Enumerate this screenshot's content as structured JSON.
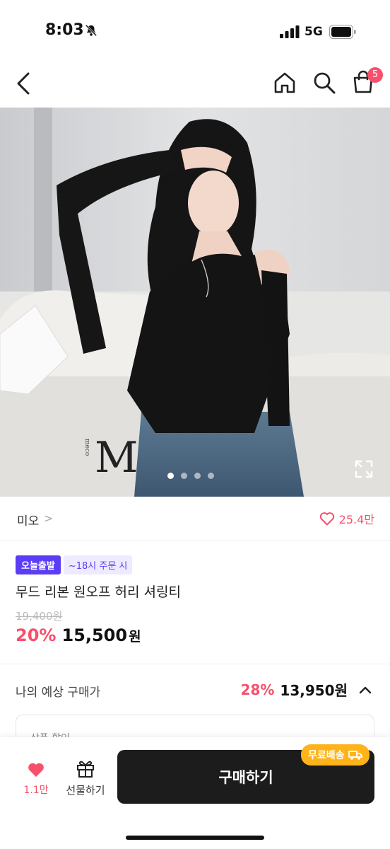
{
  "status_bar": {
    "time": "8:03",
    "network": "5G"
  },
  "nav": {
    "cart_count": "5"
  },
  "hero": {
    "brand_mark": "M",
    "brand_mark_small": "meco",
    "page_count": 4,
    "current_page": 1
  },
  "seller": {
    "name": "미오",
    "chevron": ">",
    "likes": "25.4만"
  },
  "product": {
    "badge_today": "오늘출발",
    "badge_time": "~18시 주문 시",
    "title": "무드 리본 원오프 허리 셔링티",
    "original_price": "19,400원",
    "discount": "20%",
    "sale_price": "15,500",
    "sale_unit": "원"
  },
  "expected": {
    "label": "나의 예상 구매가",
    "discount": "28%",
    "price": "13,950원"
  },
  "coupon": {
    "label": "상품 할인"
  },
  "bottom": {
    "like_count": "1.1만",
    "gift_label": "선물하기",
    "buy_label": "구매하기",
    "free_ship": "무료배송"
  },
  "colors": {
    "accent": "#f7506b",
    "badge_purple": "#5b3df5",
    "ship_orange": "#ffb31a",
    "buy_bg": "#1c1c1c"
  }
}
